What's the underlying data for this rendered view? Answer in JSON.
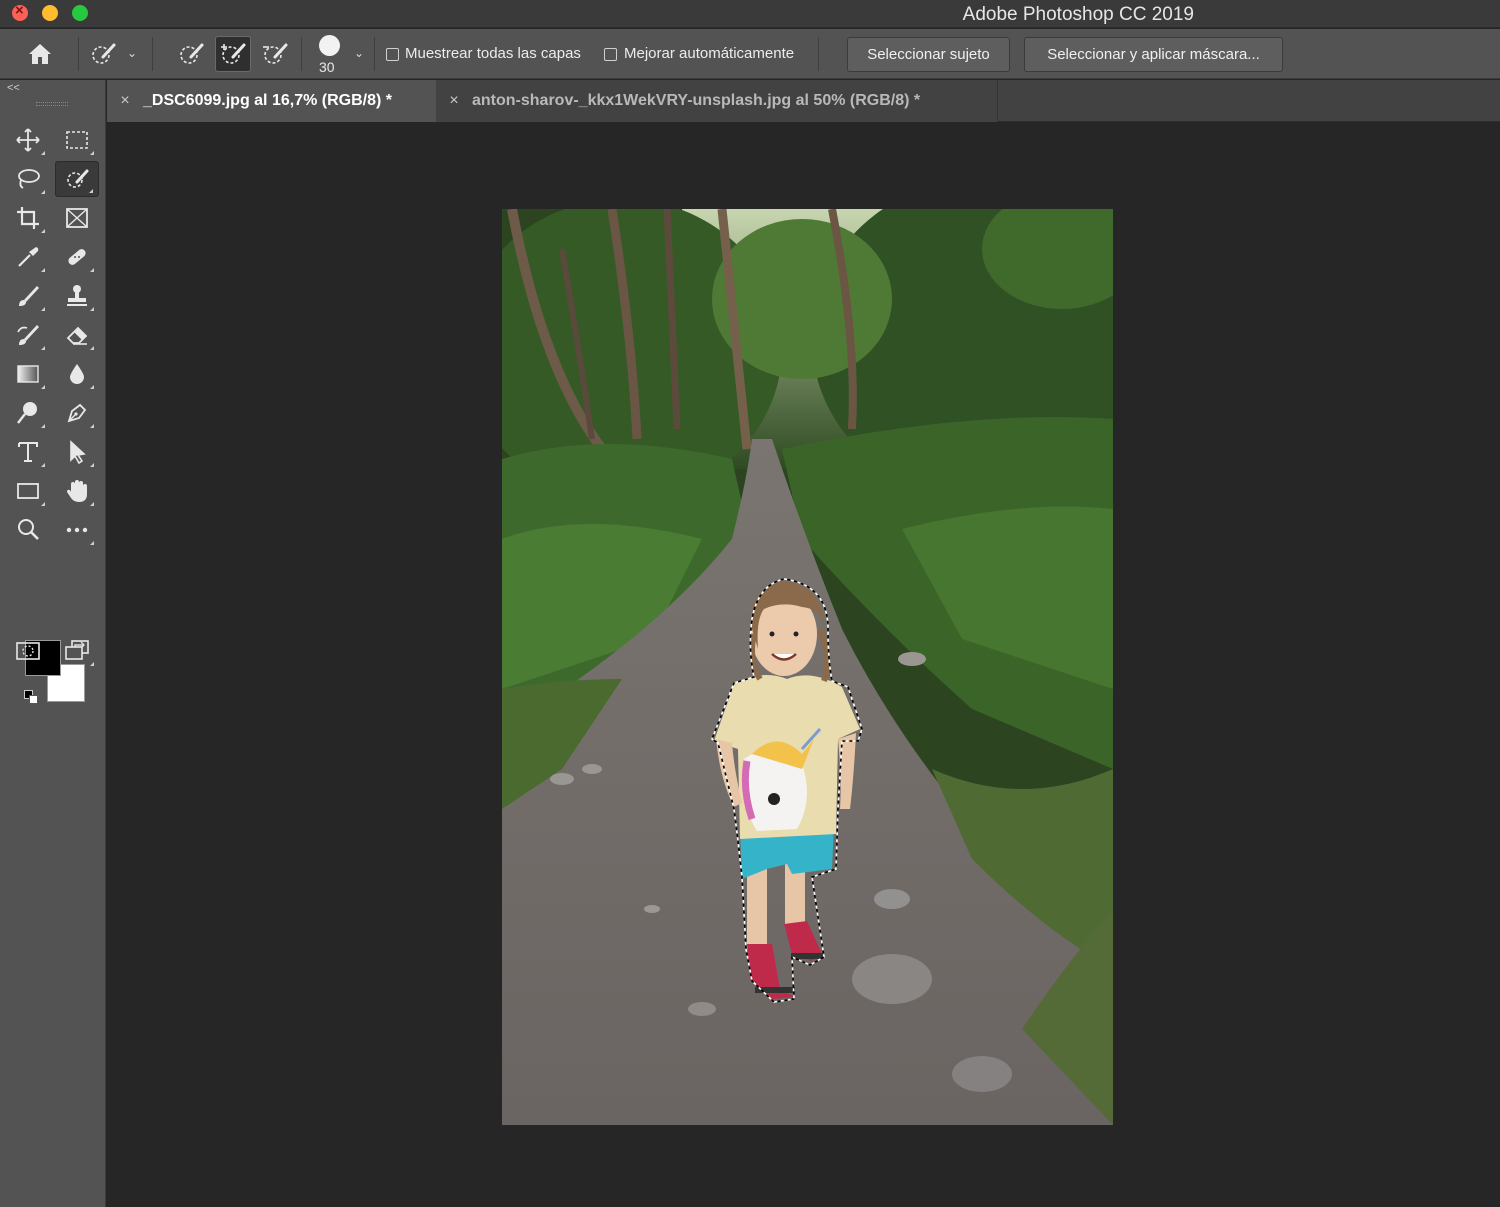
{
  "window": {
    "title": "Adobe Photoshop CC 2019",
    "traffic_lights": [
      "close",
      "minimize",
      "maximize"
    ]
  },
  "options_bar": {
    "home_icon": "home-icon",
    "tool_preset_icon": "quick-selection-icon",
    "brush_size": "30",
    "sample_all_layers_label": "Muestrear todas las capas",
    "sample_all_layers_checked": false,
    "auto_enhance_label": "Mejorar automáticamente",
    "auto_enhance_checked": false,
    "select_subject_label": "Seleccionar sujeto",
    "select_and_mask_label": "Seleccionar y aplicar máscara..."
  },
  "tabs": [
    {
      "label": "_DSC6099.jpg al 16,7% (RGB/8) *",
      "active": true
    },
    {
      "label": "anton-sharov-_kkx1WekVRY-unsplash.jpg al 50% (RGB/8) *",
      "active": false
    }
  ],
  "toolbar": {
    "collapse_label": "<<",
    "tools": [
      "move-tool",
      "rectangular-marquee-tool",
      "lasso-tool",
      "quick-selection-tool",
      "crop-tool",
      "frame-tool",
      "eyedropper-tool",
      "spot-healing-tool",
      "brush-tool",
      "clone-stamp-tool",
      "history-brush-tool",
      "eraser-tool",
      "gradient-tool",
      "blur-tool",
      "dodge-tool",
      "pen-tool",
      "type-tool",
      "path-selection-tool",
      "rectangle-tool",
      "hand-tool",
      "zoom-tool",
      "edit-toolbar"
    ],
    "foreground_color": "#000000",
    "background_color": "#ffffff"
  },
  "colors": {
    "panel": "#535353",
    "canvas_bg": "#262626",
    "titlebar": "#3a3a3a"
  }
}
